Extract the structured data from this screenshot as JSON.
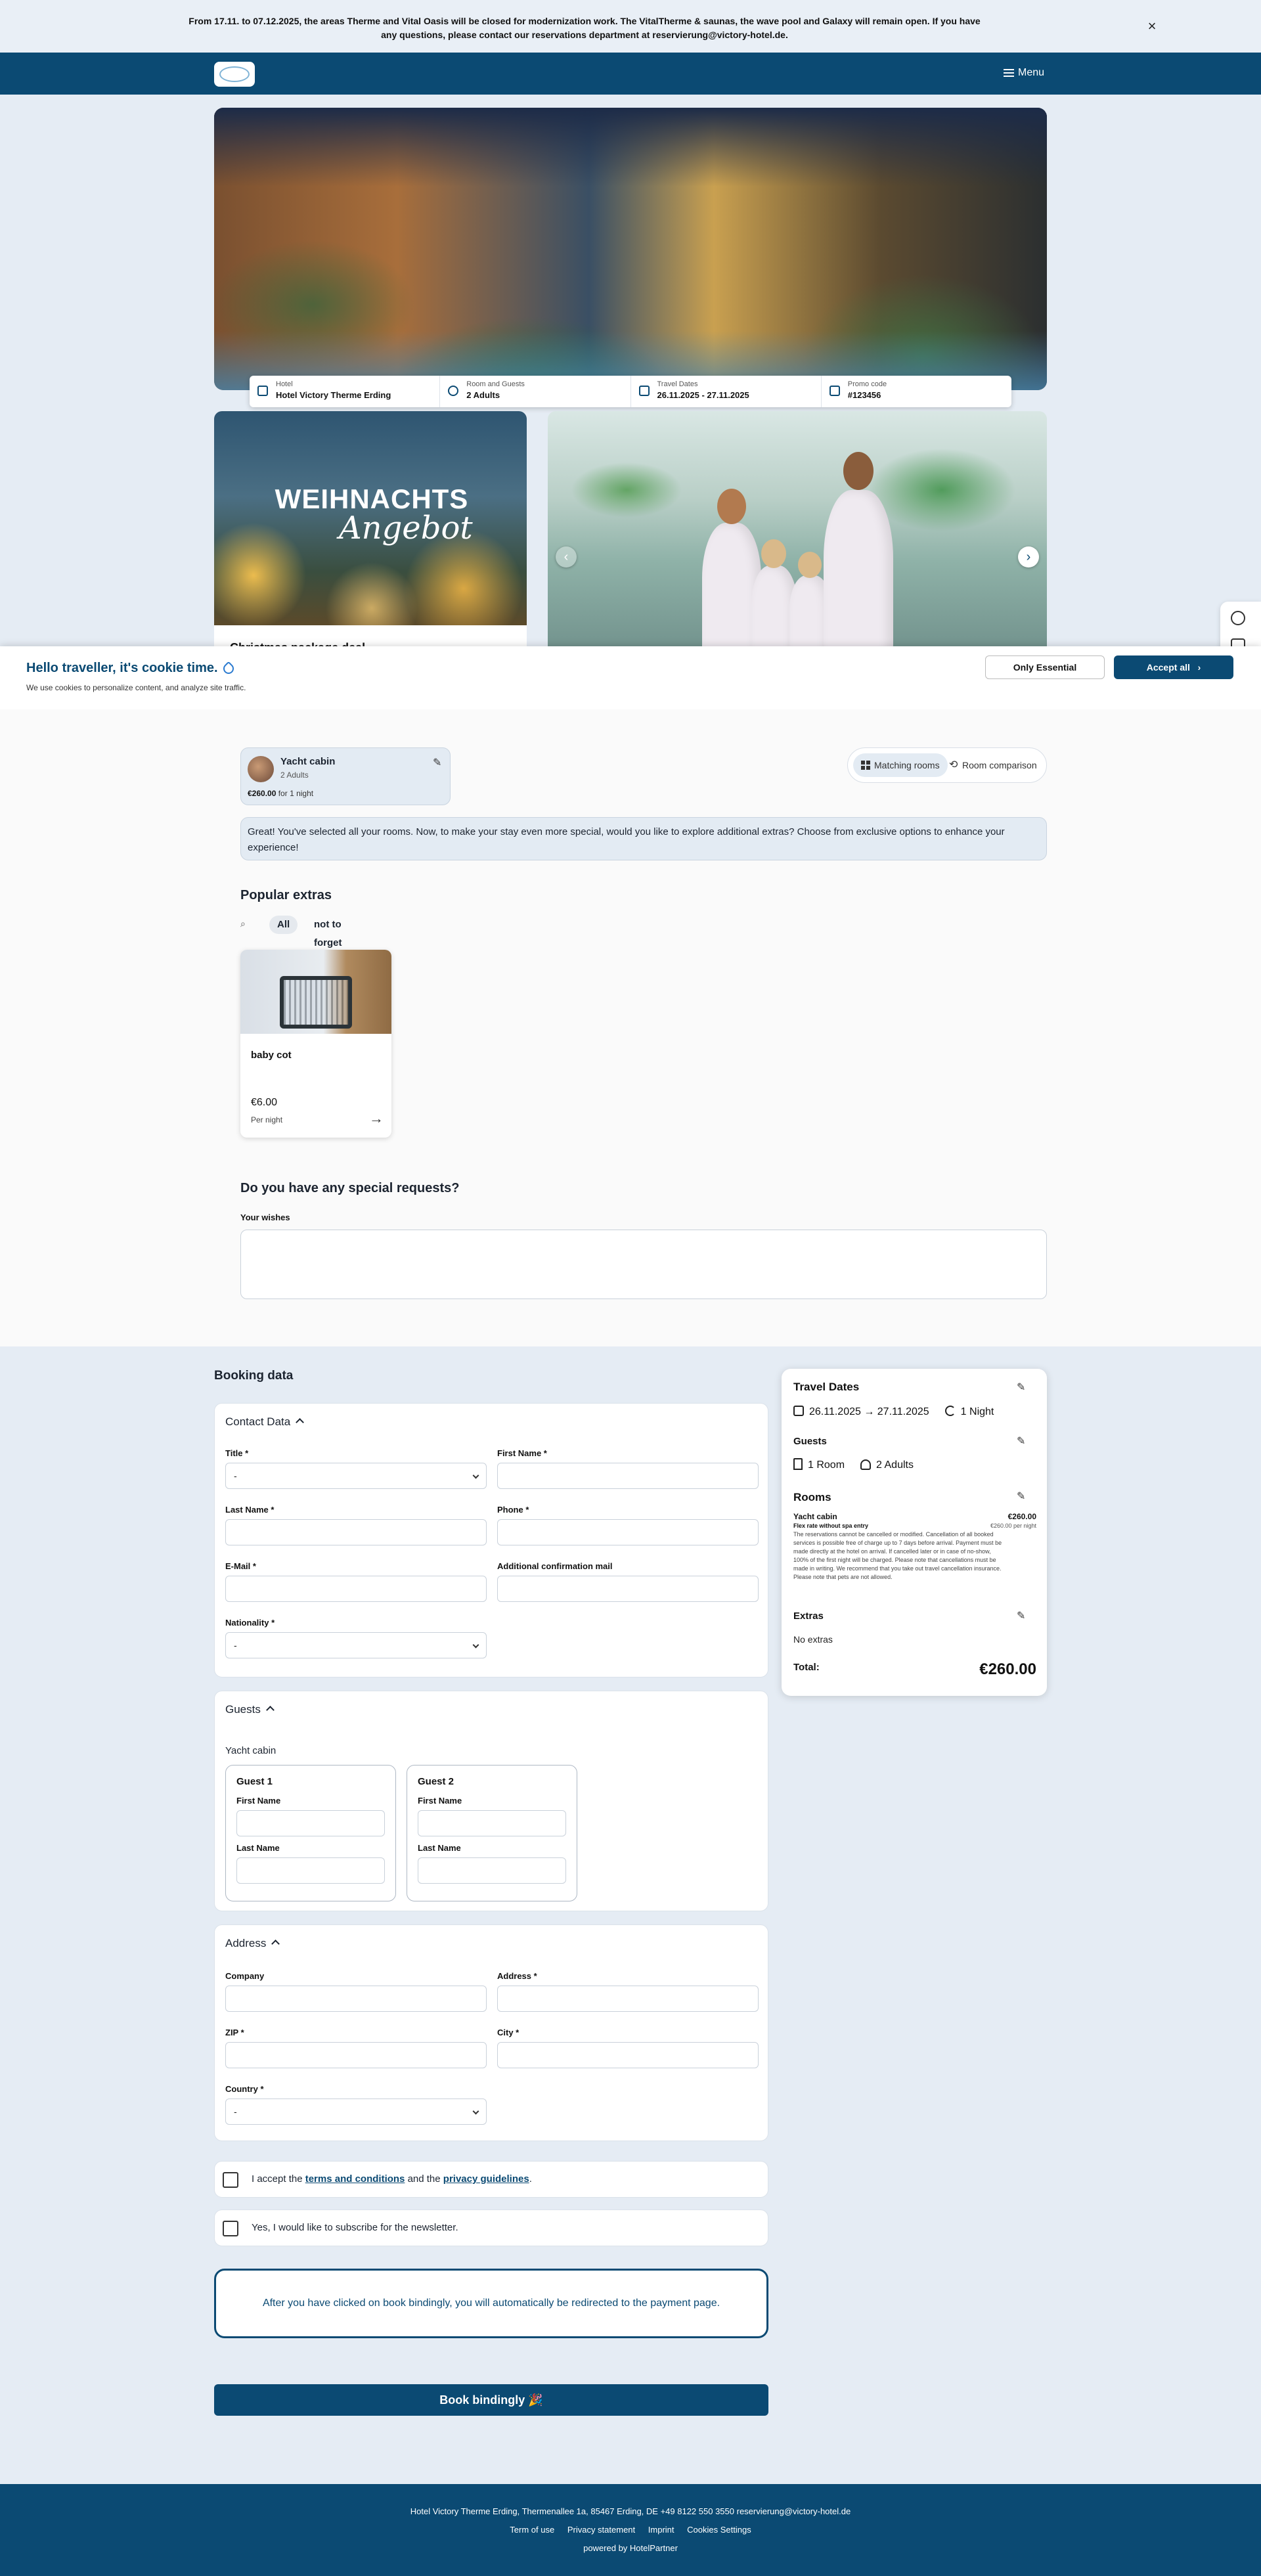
{
  "announcement": {
    "text": "From 17.11. to 07.12.2025, the areas Therme and Vital Oasis will be closed for modernization work. The VitalTherme & saunas, the wave pool and Galaxy will remain open. If you have any questions, please contact our reservations department at reservierung@victory-hotel.de.",
    "close_icon": "×"
  },
  "header": {
    "menu_label": "Menu"
  },
  "searchbar": {
    "hotel_label": "Hotel",
    "hotel_value": "Hotel Victory Therme Erding",
    "room_label": "Room and Guests",
    "room_value": "2 Adults",
    "dates_label": "Travel Dates",
    "dates_value": "26.11.2025 - 27.11.2025",
    "promo_label": "Promo code",
    "promo_value": "#123456"
  },
  "offers": {
    "offer1_title": "WEIHNACHTS",
    "offer1_sub": "Angebot",
    "offer1_caption": "Christmas package deal"
  },
  "cookie": {
    "title": "Hello traveller, it's cookie time.",
    "text": "We use cookies to personalize content, and analyze site traffic.",
    "essential_label": "Only Essential",
    "accept_label": "Accept all",
    "accept_chevron": "›"
  },
  "room_chip": {
    "name": "Yacht cabin",
    "guests": "2 Adults",
    "price": "€260.00",
    "price_suffix": " for 1 night",
    "edit_icon": "✎"
  },
  "view_toggle": {
    "matching": "Matching rooms",
    "comparison": "Room comparison",
    "comparison_icon": "⟲"
  },
  "info_banner": "Great! You've selected all your rooms. Now, to make your stay even more special, would you like to explore additional extras? Choose from exclusive options to enhance your experience!",
  "extras": {
    "title": "Popular extras",
    "search_icon": "⌕",
    "filters": [
      "All",
      "not to forget"
    ],
    "items": [
      {
        "name": "baby cot",
        "price": "€6.00",
        "unit": "Per night",
        "arrow": "→"
      }
    ]
  },
  "special_requests": {
    "title": "Do you have any special requests?",
    "label": "Your wishes",
    "value": ""
  },
  "booking": {
    "title": "Booking data",
    "contact": {
      "heading": "Contact Data",
      "title_label": "Title *",
      "title_value": "-",
      "first_name_label": "First Name *",
      "last_name_label": "Last Name *",
      "phone_label": "Phone *",
      "email_label": "E-Mail *",
      "additional_mail_label": "Additional confirmation mail",
      "nationality_label": "Nationality *",
      "nationality_value": "-"
    },
    "guests": {
      "heading": "Guests",
      "room_name": "Yacht cabin",
      "cards": [
        {
          "title": "Guest 1",
          "first_label": "First Name",
          "last_label": "Last Name"
        },
        {
          "title": "Guest 2",
          "first_label": "First Name",
          "last_label": "Last Name"
        }
      ]
    },
    "address": {
      "heading": "Address",
      "company_label": "Company",
      "address_label": "Address *",
      "zip_label": "ZIP *",
      "city_label": "City *",
      "country_label": "Country *",
      "country_value": "-"
    },
    "terms": {
      "prefix": "I accept the ",
      "terms_link": "terms and conditions",
      "middle": " and the ",
      "privacy_link": "privacy guidelines",
      "suffix": "."
    },
    "newsletter": "Yes, I would like to subscribe for the newsletter.",
    "redirect_note": "After you have clicked on book bindingly, you will automatically be redirected to the payment page.",
    "book_label": "Book bindingly 🎉"
  },
  "summary": {
    "travel_dates_title": "Travel Dates",
    "dates": "26.11.2025 → 27.11.2025",
    "nights": "1 Night",
    "guests_title": "Guests",
    "rooms_count": "1 Room",
    "adults": "2 Adults",
    "rooms_title": "Rooms",
    "room_name": "Yacht cabin",
    "room_rate": "Flex rate without spa entry",
    "room_terms": "The reservations cannot be cancelled or modified. Cancellation of all booked services is possible free of charge up to 7 days before arrival. Payment must be made directly at the hotel on arrival. If cancelled later or in case of no-show, 100% of the first night will be charged. Please note that cancellations must be made in writing. We recommend that you take out travel cancellation insurance. Please note that pets are not allowed.",
    "room_price": "€260.00",
    "room_per": "€260.00 per night",
    "extras_title": "Extras",
    "extras_value": "No extras",
    "total_label": "Total:",
    "total_value": "€260.00",
    "edit_icon": "✎"
  },
  "footer": {
    "address": "Hotel Victory Therme Erding, Thermenallee 1a, 85467 Erding, DE    +49 8122 550 3550    reservierung@victory-hotel.de",
    "links": [
      "Term of use",
      "Privacy statement",
      "Imprint",
      "Cookies Settings"
    ],
    "powered": "powered by HotelPartner"
  },
  "colors": {
    "brand": "#0b4a73",
    "background": "#e5ecf4",
    "surface": "#ffffff"
  }
}
